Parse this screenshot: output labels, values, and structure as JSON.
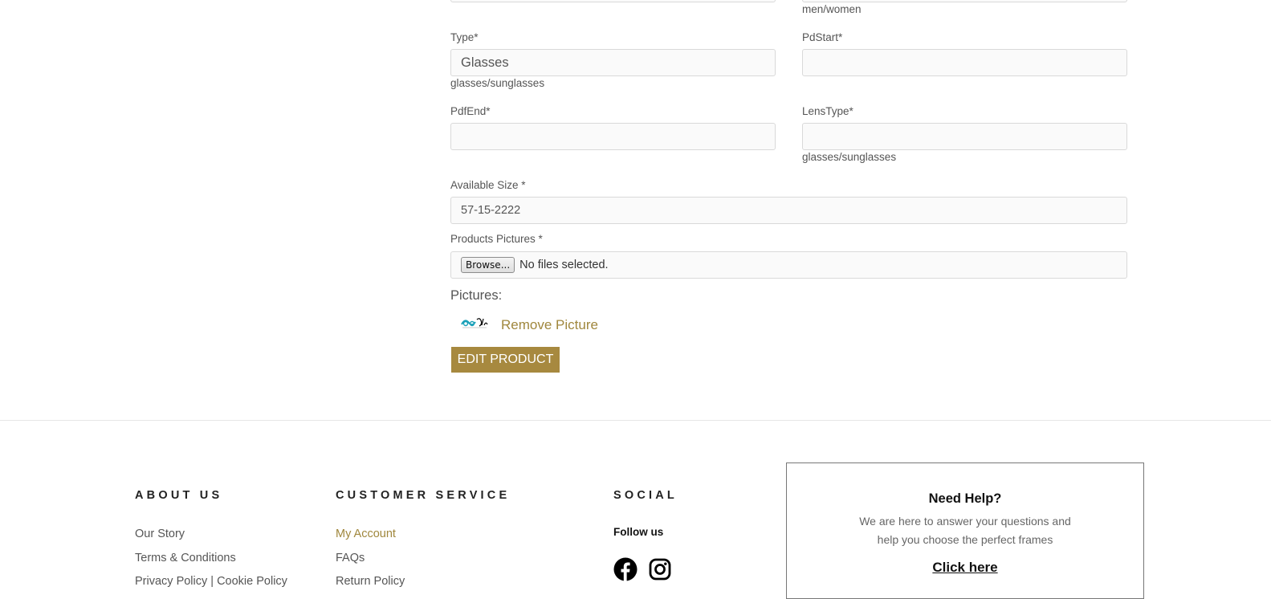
{
  "form": {
    "gender_hint": "men/women",
    "type": {
      "label": "Type*",
      "value": "Glasses",
      "hint": "glasses/sunglasses"
    },
    "pd_start": {
      "label": "PdStart*",
      "value": ""
    },
    "pdf_end": {
      "label": "PdfEnd*",
      "value": ""
    },
    "lens_type": {
      "label": "LensType*",
      "value": "",
      "hint": "glasses/sunglasses"
    },
    "available_size": {
      "label": "Available Size *",
      "value": "57-15-2222"
    },
    "products_pictures": {
      "label": "Products Pictures *",
      "browse_label": "Browse...",
      "status": "No files selected."
    },
    "pictures": {
      "heading": "Pictures:",
      "remove_label": "Remove Picture"
    },
    "submit_label": "EDIT PRODUCT"
  },
  "footer": {
    "about": {
      "heading": "ABOUT US",
      "links": [
        "Our Story",
        "Terms & Conditions",
        "Privacy Policy | Cookie Policy"
      ]
    },
    "customer_service": {
      "heading": "CUSTOMER SERVICE",
      "links": [
        "My Account",
        "FAQs",
        "Return Policy"
      ]
    },
    "social": {
      "heading": "SOCIAL",
      "follow_label": "Follow us",
      "icons": [
        "facebook-icon",
        "instagram-icon"
      ]
    },
    "help": {
      "title": "Need Help?",
      "text_line1": "We are here to answer your questions and",
      "text_line2": "help you choose the perfect frames",
      "link_label": "Click here"
    }
  },
  "colors": {
    "accent": "#a7893f",
    "link_gold": "#a0873d"
  }
}
